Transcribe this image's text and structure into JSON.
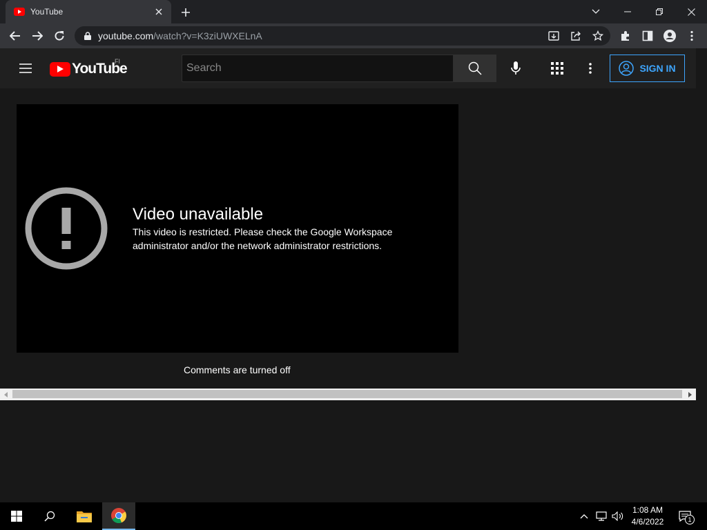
{
  "browser": {
    "tab_title": "YouTube",
    "url_host": "youtube.com",
    "url_path": "/watch?v=K3ziUWXELnA"
  },
  "youtube": {
    "logo_text": "YouTube",
    "region": "FI",
    "search_placeholder": "Search",
    "sign_in_label": "SIGN IN"
  },
  "player": {
    "error_title": "Video unavailable",
    "error_message": "This video is restricted. Please check the Google Workspace administrator and/or the network administrator restrictions."
  },
  "comments_status": "Comments are turned off",
  "taskbar": {
    "time": "1:08 AM",
    "date": "4/6/2022",
    "notification_count": "1"
  },
  "colors": {
    "youtube_red": "#ff0000",
    "sign_in_blue": "#3ea6ff",
    "page_bg": "#181818"
  }
}
